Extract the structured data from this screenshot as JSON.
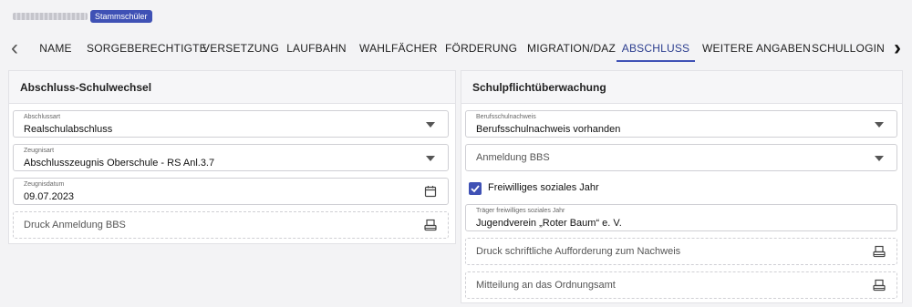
{
  "header": {
    "role_badge": "Stammschüler"
  },
  "tabs": [
    {
      "label": "NAME"
    },
    {
      "label": "SORGEBERECHTIGTE"
    },
    {
      "label": "VERSETZUNG"
    },
    {
      "label": "LAUFBAHN"
    },
    {
      "label": "WAHLFÄCHER"
    },
    {
      "label": "FÖRDERUNG"
    },
    {
      "label": "MIGRATION/DAZ"
    },
    {
      "label": "ABSCHLUSS"
    },
    {
      "label": "WEITERE ANGABEN"
    },
    {
      "label": "SCHULLOGIN"
    }
  ],
  "active_tab": "ABSCHLUSS",
  "left_card": {
    "title": "Abschluss-Schulwechsel",
    "abschlussart": {
      "label": "Abschlussart",
      "value": "Realschulabschluss"
    },
    "zeugnisart": {
      "label": "Zeugnisart",
      "value": "Abschlusszeugnis Oberschule - RS Anl.3.7"
    },
    "zeugnisdatum": {
      "label": "Zeugnisdatum",
      "value": "09.07.2023"
    },
    "print_button": "Druck Anmeldung BBS"
  },
  "right_card": {
    "title": "Schulpflichtüberwachung",
    "berufsschulnachweis": {
      "label": "Berufsschulnachweis",
      "value": "Berufsschulnachweis vorhanden"
    },
    "anmeldung_bbs": {
      "placeholder": "Anmeldung BBS"
    },
    "fsj_checkbox": {
      "label": "Freiwilliges soziales Jahr",
      "checked": true
    },
    "traeger": {
      "label": "Träger freiwilliges soziales Jahr",
      "value": "Jugendverein „Roter Baum“ e. V."
    },
    "print_request": "Druck schriftliche Aufforderung zum Nachweis",
    "print_notice": "Mitteilung an das Ordnungsamt"
  },
  "colors": {
    "accent": "#3f51b5",
    "background": "#f3f3f5"
  },
  "icons": [
    "chevron-left-icon",
    "chevron-right-icon",
    "dropdown-caret-icon",
    "calendar-icon",
    "printer-icon",
    "checkbox-checked-icon"
  ]
}
